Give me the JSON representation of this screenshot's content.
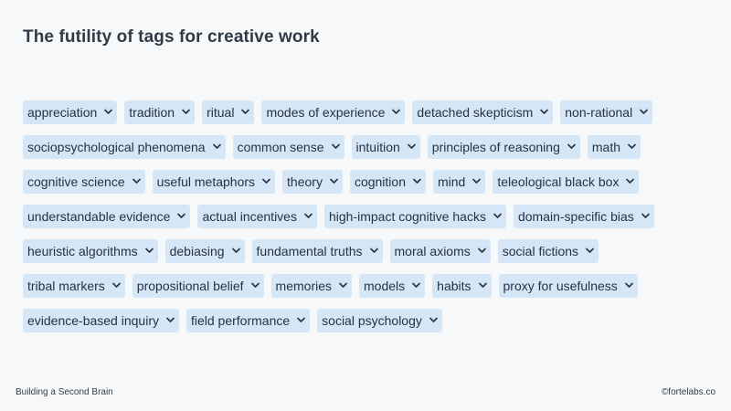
{
  "title": "The futility of tags for creative work",
  "tag_rows": [
    [
      "appreciation",
      "tradition",
      "ritual",
      "modes of experience",
      "detached skepticism",
      "non-rational"
    ],
    [
      "sociopsychological phenomena",
      "common sense",
      "intuition",
      "principles of reasoning",
      "math"
    ],
    [
      "cognitive science",
      "useful metaphors",
      "theory",
      "cognition",
      "mind",
      "teleological black box"
    ],
    [
      "understandable evidence",
      "actual incentives",
      "high-impact cognitive hacks",
      "domain-specific bias"
    ],
    [
      "heuristic algorithms",
      "debiasing",
      "fundamental truths",
      "moral axioms",
      "social fictions"
    ],
    [
      "tribal markers",
      "propositional belief",
      "memories",
      "models",
      "habits",
      "proxy for usefulness"
    ],
    [
      "evidence-based inquiry",
      "field performance",
      "social psychology"
    ]
  ],
  "tag_icon": "chevron-down-icon",
  "colors": {
    "background": "#f7f8f9",
    "tag_background": "#d5e7f7",
    "text": "#26333f"
  },
  "footer": {
    "left": "Building a Second Brain",
    "right": "©fortelabs.co"
  }
}
